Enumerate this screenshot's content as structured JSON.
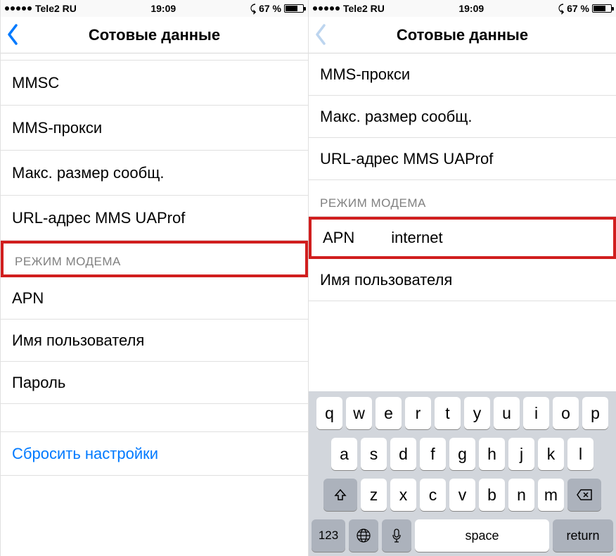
{
  "status": {
    "carrier": "Tele2 RU",
    "time": "19:09",
    "battery": "67 %"
  },
  "nav": {
    "title": "Сотовые данные"
  },
  "left": {
    "rows": {
      "mmsc": "MMSC",
      "mms_proxy": "MMS-прокси",
      "max_msg": "Макс. размер сообщ.",
      "mms_uaprof": "URL-адрес MMS UAProf"
    },
    "section": "РЕЖИМ МОДЕМА",
    "modem": {
      "apn": "APN",
      "user": "Имя пользователя",
      "pass": "Пароль"
    },
    "reset": "Сбросить настройки"
  },
  "right": {
    "rows": {
      "mms_proxy": "MMS-прокси",
      "max_msg": "Макс. размер сообщ.",
      "mms_uaprof": "URL-адрес MMS UAProf"
    },
    "section": "РЕЖИМ МОДЕМА",
    "modem": {
      "apn_label": "APN",
      "apn_value": "internet",
      "user": "Имя пользователя"
    }
  },
  "kbd": {
    "r1": [
      "q",
      "w",
      "e",
      "r",
      "t",
      "y",
      "u",
      "i",
      "o",
      "p"
    ],
    "r2": [
      "a",
      "s",
      "d",
      "f",
      "g",
      "h",
      "j",
      "k",
      "l"
    ],
    "r3": [
      "z",
      "x",
      "c",
      "v",
      "b",
      "n",
      "m"
    ],
    "num": "123",
    "space": "space",
    "return": "return"
  }
}
